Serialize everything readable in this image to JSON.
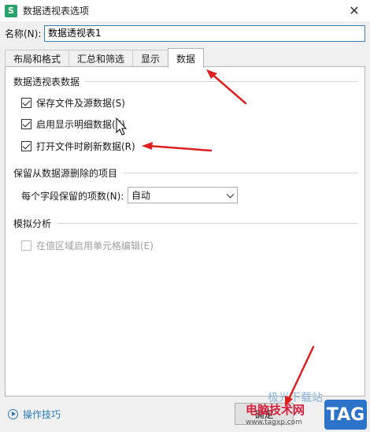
{
  "window": {
    "title": "数据透视表选项",
    "app_icon_letter": "S",
    "close_glyph": "✕"
  },
  "name_field": {
    "label": "名称(N):",
    "value": "数据透视表1"
  },
  "tabs": [
    {
      "label": "布局和格式",
      "active": false
    },
    {
      "label": "汇总和筛选",
      "active": false
    },
    {
      "label": "显示",
      "active": false
    },
    {
      "label": "数据",
      "active": true
    }
  ],
  "groups": {
    "pivot_data": {
      "title": "数据透视表数据",
      "options": [
        {
          "label": "保存文件及源数据(S)",
          "checked": true
        },
        {
          "label": "启用显示明细数据(E)",
          "checked": true
        },
        {
          "label": "打开文件时刷新数据(R)",
          "checked": true
        }
      ]
    },
    "retain_items": {
      "title": "保留从数据源删除的项目",
      "field_label": "每个字段保留的项数(N):",
      "selected": "自动"
    },
    "what_if": {
      "title": "模拟分析",
      "option_label": "在值区域启用单元格编辑(E)",
      "checked": false,
      "disabled": true
    }
  },
  "footer": {
    "tips_label": "操作技巧",
    "ok_label": "确定"
  },
  "watermark": {
    "site_name": "电脑技术网",
    "url": "www.tagxp.com",
    "tag": "TAG",
    "faded_text": "极光下载站"
  },
  "annotation_color": "#e02020",
  "accent_color": "#2a7ab8"
}
